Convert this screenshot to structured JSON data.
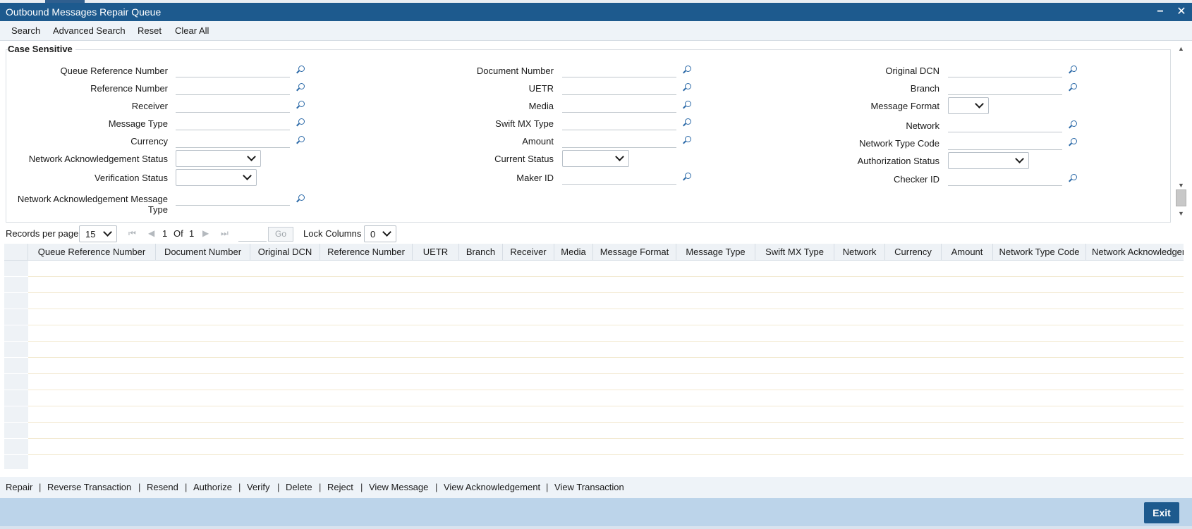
{
  "window": {
    "title": "Outbound Messages Repair Queue",
    "minimize_label": "−",
    "close_label": "✕"
  },
  "toolbar": {
    "search": "Search",
    "advanced_search": "Advanced Search",
    "reset": "Reset",
    "clear_all": "Clear All"
  },
  "panel": {
    "legend": "Case Sensitive"
  },
  "fields": {
    "queue_reference_number": "Queue Reference Number",
    "reference_number": "Reference Number",
    "receiver": "Receiver",
    "message_type": "Message Type",
    "currency": "Currency",
    "network_ack_status": "Network Acknowledgement Status",
    "verification_status": "Verification Status",
    "network_ack_message_type_line1": "Network Acknowledgement Message",
    "network_ack_message_type_line2": "Type",
    "document_number": "Document Number",
    "uetr": "UETR",
    "media": "Media",
    "swift_mx_type": "Swift MX Type",
    "amount": "Amount",
    "current_status": "Current Status",
    "maker_id": "Maker ID",
    "original_dcn": "Original DCN",
    "branch": "Branch",
    "message_format": "Message Format",
    "network": "Network",
    "network_type_code": "Network Type Code",
    "authorization_status": "Authorization Status",
    "checker_id": "Checker ID"
  },
  "pager": {
    "records_per_page_label": "Records per page",
    "records_per_page_value": "15",
    "current_page": "1",
    "of_label": "Of",
    "total_pages": "1",
    "go_label": "Go",
    "lock_columns_label": "Lock Columns",
    "lock_columns_value": "0"
  },
  "grid": {
    "columns": [
      "Queue Reference Number",
      "Document Number",
      "Original DCN",
      "Reference Number",
      "UETR",
      "Branch",
      "Receiver",
      "Media",
      "Message Format",
      "Message Type",
      "Swift MX Type",
      "Network",
      "Currency",
      "Amount",
      "Network Type Code",
      "Network Acknowledgem"
    ],
    "rows": []
  },
  "actions": {
    "repair": "Repair",
    "reverse_transaction": "Reverse Transaction",
    "resend": "Resend",
    "authorize": "Authorize",
    "verify": "Verify",
    "delete": "Delete",
    "reject": "Reject",
    "view_message": "View Message",
    "view_acknowledgement": "View Acknowledgement",
    "view_transaction": "View Transaction",
    "separator": "|"
  },
  "footer": {
    "exit": "Exit"
  },
  "colors": {
    "titlebar": "#1d5a8e",
    "toolbar_bg": "#eef3f8",
    "footer_bg": "#bcd4ea",
    "lens_icon": "#2c6aa8"
  }
}
